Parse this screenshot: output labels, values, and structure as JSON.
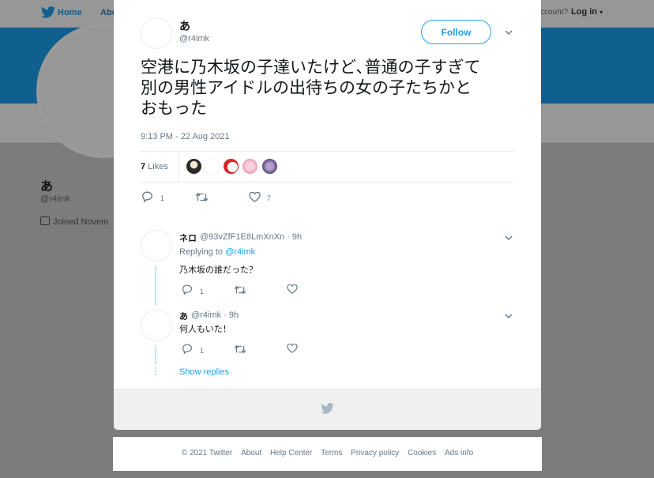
{
  "background": {
    "nav": {
      "home_label": "Home",
      "about_label": "Abo",
      "account_prompt": "ccount?",
      "login_label": "Log in"
    },
    "profile": {
      "name": "あ",
      "handle": "@r4imk",
      "joined": "Joined Novem"
    },
    "colors": {
      "banner": "#0f5f8f",
      "overlay": "#7c7c7c"
    }
  },
  "tweet": {
    "author_name": "あ",
    "author_handle": "@r4imk",
    "follow_label": "Follow",
    "text_lines": [
      "空港に乃木坂の子達いたけど､普通の子すぎて",
      "別の男性アイドルの出待ちの女の子たちかと",
      "おもった"
    ],
    "timestamp": "9:13 PM - 22 Aug 2021",
    "likes_count": "7",
    "likes_label": "Likes",
    "actions": {
      "reply_count": "1",
      "retweet_count": "",
      "like_count": "7"
    }
  },
  "replies": [
    {
      "name": "ネロ",
      "meta": "@93vZfF1E8LmXnXn · 9h",
      "replying_to_label": "Replying to",
      "replying_to_handle": "@r4imk",
      "text": "乃木坂の誰だった？",
      "reply_count": "1"
    },
    {
      "name": "あ",
      "meta": "@r4imk · 9h",
      "text": "何人もいた！",
      "reply_count": "1"
    }
  ],
  "show_replies_label": "Show replies",
  "footer_links": [
    "© 2021 Twitter",
    "About",
    "Help Center",
    "Terms",
    "Privacy policy",
    "Cookies",
    "Ads info"
  ],
  "accent_color": "#1da1f2"
}
